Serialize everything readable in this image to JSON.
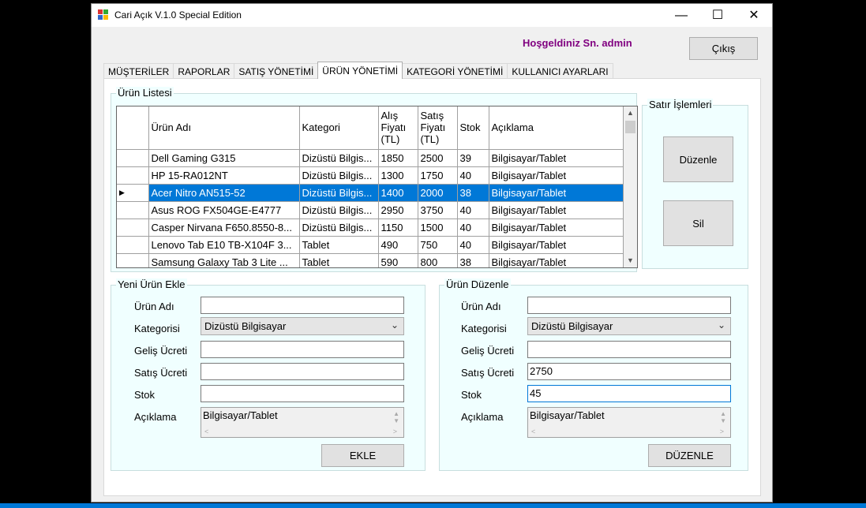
{
  "window": {
    "title": "Cari Açık V.1.0 Special Edition",
    "minimize": "—",
    "maximize": "☐",
    "close": "✕"
  },
  "header": {
    "welcome": "Hoşgeldiniz Sn. admin",
    "exit_label": "Çıkış"
  },
  "tabs": [
    "MÜŞTERİLER",
    "RAPORLAR",
    "SATIŞ YÖNETİMİ",
    "ÜRÜN YÖNETİMİ",
    "KATEGORİ YÖNETİMİ",
    "KULLANICI AYARLARI"
  ],
  "active_tab": "ÜRÜN YÖNETİMİ",
  "product_list": {
    "title": "Ürün Listesi",
    "columns": [
      "Ürün Adı",
      "Kategori",
      "Alış Fiyatı (TL)",
      "Satış Fiyatı (TL)",
      "Stok",
      "Açıklama"
    ],
    "rows": [
      [
        "Dell Gaming G315",
        "Dizüstü Bilgis...",
        "1850",
        "2500",
        "39",
        "Bilgisayar/Tablet"
      ],
      [
        "HP 15-RA012NT",
        "Dizüstü Bilgis...",
        "1300",
        "1750",
        "40",
        "Bilgisayar/Tablet"
      ],
      [
        "Acer Nitro AN515-52",
        "Dizüstü Bilgis...",
        "1400",
        "2000",
        "38",
        "Bilgisayar/Tablet"
      ],
      [
        "Asus ROG FX504GE-E4777",
        "Dizüstü Bilgis...",
        "2950",
        "3750",
        "40",
        "Bilgisayar/Tablet"
      ],
      [
        "Casper Nirvana F650.8550-8...",
        "Dizüstü Bilgis...",
        "1150",
        "1500",
        "40",
        "Bilgisayar/Tablet"
      ],
      [
        "Lenovo Tab E10 TB-X104F 3...",
        "Tablet",
        "490",
        "750",
        "40",
        "Bilgisayar/Tablet"
      ],
      [
        "Samsung Galaxy Tab 3 Lite ...",
        "Tablet",
        "590",
        "800",
        "38",
        "Bilgisayar/Tablet"
      ]
    ],
    "selected_row": 2,
    "row_pointer": "▶"
  },
  "row_actions": {
    "title": "Satır İşlemleri",
    "edit_label": "Düzenle",
    "delete_label": "Sil"
  },
  "new_product": {
    "title": "Yeni Ürün Ekle",
    "labels": {
      "name": "Ürün Adı",
      "category": "Kategorisi",
      "buy_price": "Geliş Ücreti",
      "sell_price": "Satış Ücreti",
      "stock": "Stok",
      "description": "Açıklama"
    },
    "values": {
      "name": "",
      "category": "Dizüstü Bilgisayar",
      "buy_price": "",
      "sell_price": "",
      "stock": "",
      "description": "Bilgisayar/Tablet"
    },
    "submit_label": "EKLE"
  },
  "edit_product": {
    "title": "Ürün Düzenle",
    "labels": {
      "name": "Ürün Adı",
      "category": "Kategorisi",
      "buy_price": "Geliş Ücreti",
      "sell_price": "Satış Ücreti",
      "stock": "Stok",
      "description": "Açıklama"
    },
    "values": {
      "name": "",
      "category": "Dizüstü Bilgisayar",
      "buy_price": "",
      "sell_price": "2750",
      "stock": "45",
      "description": "Bilgisayar/Tablet"
    },
    "submit_label": "DÜZENLE"
  },
  "icons": {
    "dropdown": "chevron-down-icon",
    "scroll_up": "scroll-up-arrow-icon",
    "scroll_down": "scroll-down-arrow-icon"
  },
  "colors": {
    "selection": "#0078d7",
    "welcome_text": "#800080",
    "group_bg": "#f0ffff"
  }
}
